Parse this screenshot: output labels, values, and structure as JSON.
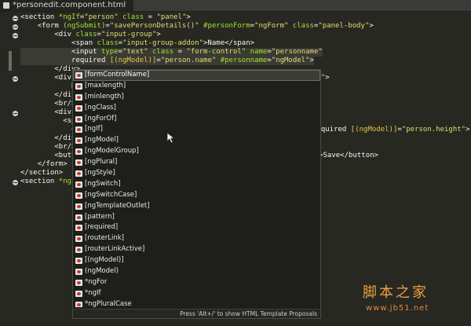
{
  "tab": {
    "title": "*personedit.component.html"
  },
  "code_lines": [
    {
      "indent": "",
      "parts": [
        [
          "t",
          "<section "
        ],
        [
          "a",
          "*ngIf"
        ],
        [
          "t",
          "="
        ],
        [
          "s",
          "\"person\""
        ],
        [
          "t",
          " "
        ],
        [
          "a",
          "class"
        ],
        [
          "t",
          " = "
        ],
        [
          "s",
          "\"panel\""
        ],
        [
          "t",
          ">"
        ]
      ]
    },
    {
      "indent": "    ",
      "parts": [
        [
          "t",
          "<form "
        ],
        [
          "a",
          "(ngSubmit)"
        ],
        [
          "t",
          "="
        ],
        [
          "s",
          "\"savePersonDetails()\""
        ],
        [
          "t",
          " "
        ],
        [
          "a",
          "#personForm"
        ],
        [
          "t",
          "="
        ],
        [
          "s",
          "\"ngForm\""
        ],
        [
          "t",
          " "
        ],
        [
          "a",
          "class"
        ],
        [
          "t",
          "="
        ],
        [
          "s",
          "\"panel-body\""
        ],
        [
          "t",
          ">"
        ]
      ]
    },
    {
      "indent": "        ",
      "parts": [
        [
          "t",
          "<div "
        ],
        [
          "a",
          "class"
        ],
        [
          "t",
          "="
        ],
        [
          "s",
          "\"input-group\""
        ],
        [
          "t",
          ">"
        ]
      ]
    },
    {
      "indent": "            ",
      "parts": [
        [
          "t",
          "<span "
        ],
        [
          "a",
          "class"
        ],
        [
          "t",
          "="
        ],
        [
          "s",
          "\"input-group-addon\""
        ],
        [
          "t",
          ">Name</span>"
        ]
      ]
    },
    {
      "indent": "            ",
      "parts": [
        [
          "t",
          "<input "
        ],
        [
          "a",
          "type"
        ],
        [
          "t",
          "="
        ],
        [
          "s",
          "\"text\""
        ],
        [
          "t",
          " "
        ],
        [
          "a",
          "class"
        ],
        [
          "t",
          " = "
        ],
        [
          "s",
          "\"form-control\""
        ],
        [
          "t",
          " "
        ],
        [
          "a",
          "name"
        ],
        [
          "t",
          "="
        ],
        [
          "s",
          "\"personname\""
        ]
      ]
    },
    {
      "indent": "            ",
      "parts": [
        [
          "t",
          "required "
        ],
        [
          "b",
          "[(ngModel)]"
        ],
        [
          "t",
          "="
        ],
        [
          "s",
          "\"person.name\""
        ],
        [
          "t",
          " "
        ],
        [
          "a",
          "#personname"
        ],
        [
          "t",
          "="
        ],
        [
          "s",
          "\"ngModel\""
        ],
        [
          "t",
          ">"
        ]
      ]
    },
    {
      "indent": "        ",
      "parts": [
        [
          "t",
          "</div>"
        ]
      ]
    },
    {
      "indent": "        ",
      "parts": [
        [
          "t",
          "<div"
        ]
      ]
    },
    {
      "indent": "            ",
      "parts": [
        [
          "t",
          "N"
        ]
      ]
    },
    {
      "indent": "        ",
      "parts": [
        [
          "t",
          "</div"
        ]
      ]
    },
    {
      "indent": "        ",
      "parts": [
        [
          "t",
          "<br/>"
        ]
      ]
    },
    {
      "indent": "        ",
      "parts": [
        [
          "t",
          "<div"
        ]
      ]
    },
    {
      "indent": "          ",
      "parts": [
        [
          "t",
          "<sp"
        ]
      ]
    },
    {
      "indent": "            ",
      "parts": [
        [
          "t",
          "<"
        ]
      ]
    },
    {
      "indent": "        ",
      "parts": [
        [
          "t",
          "</div"
        ]
      ]
    },
    {
      "indent": "        ",
      "parts": [
        [
          "t",
          "<br/>"
        ]
      ]
    },
    {
      "indent": "        ",
      "parts": [
        [
          "t",
          "<butt"
        ]
      ]
    },
    {
      "indent": "    ",
      "parts": [
        [
          "t",
          "</form>"
        ]
      ]
    },
    {
      "indent": "",
      "parts": [
        [
          "t",
          "</section>"
        ]
      ]
    },
    {
      "indent": "",
      "parts": [
        [
          "t",
          "<section "
        ],
        [
          "a",
          "*ngIf"
        ]
      ]
    }
  ],
  "code_right": [
    {
      "row": 7,
      "parts": [
        [
          "s",
          "or\""
        ],
        [
          "t",
          ">"
        ]
      ]
    },
    {
      "row": 13,
      "parts": [
        [
          "t",
          "required "
        ],
        [
          "b",
          "[(ngModel)]"
        ],
        [
          "t",
          "="
        ],
        [
          "s",
          "\"person.height\""
        ],
        [
          "t",
          ">"
        ]
      ]
    },
    {
      "row": 16,
      "parts": [
        [
          "s",
          "\"btn\""
        ],
        [
          "t",
          ">Save</button>"
        ]
      ]
    }
  ],
  "proposals": [
    "[formControlName]",
    "[maxlength]",
    "[minlength]",
    "[ngClass]",
    "[ngForOf]",
    "[ngIf]",
    "[ngModel]",
    "[ngModelGroup]",
    "[ngPlural]",
    "[ngStyle]",
    "[ngSwitch]",
    "[ngSwitchCase]",
    "[ngTemplateOutlet]",
    "[pattern]",
    "[required]",
    "[routerLink]",
    "[routerLinkActive]",
    "[(ngModel)]",
    "(ngModel)",
    "*ngFor",
    "*ngIf",
    "*ngPluralCase"
  ],
  "selected_index": 0,
  "footer_hint": "Press 'Alt+/' to show HTML Template Proposals",
  "watermark": {
    "line1": "脚本之家",
    "line2": "www.jb51.net"
  }
}
